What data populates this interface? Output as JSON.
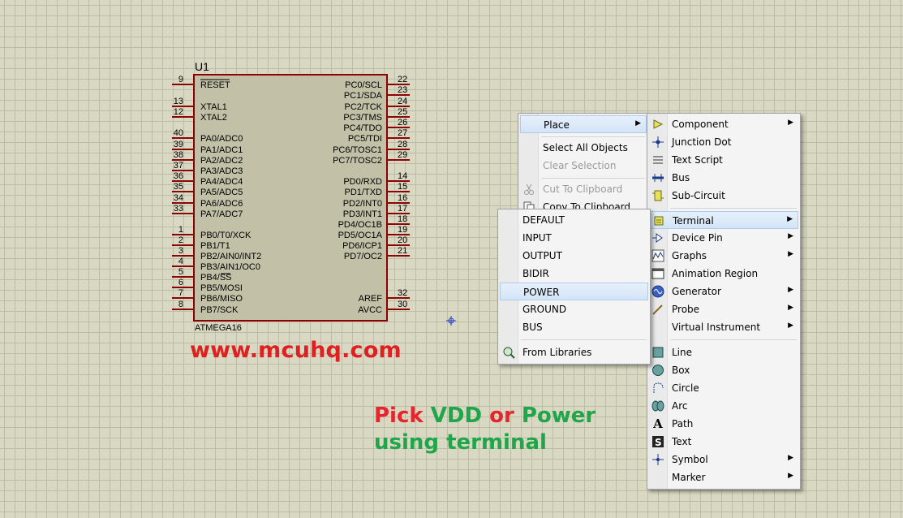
{
  "schematic": {
    "ref": "U1",
    "part": "ATMEGA16",
    "left_pins": [
      {
        "num": "9",
        "name": "RESET"
      },
      {
        "num": "13",
        "name": "XTAL1"
      },
      {
        "num": "12",
        "name": "XTAL2"
      },
      {
        "num": "40",
        "name": "PA0/ADC0"
      },
      {
        "num": "39",
        "name": "PA1/ADC1"
      },
      {
        "num": "38",
        "name": "PA2/ADC2"
      },
      {
        "num": "37",
        "name": "PA3/ADC3"
      },
      {
        "num": "36",
        "name": "PA4/ADC4"
      },
      {
        "num": "35",
        "name": "PA5/ADC5"
      },
      {
        "num": "34",
        "name": "PA6/ADC6"
      },
      {
        "num": "33",
        "name": "PA7/ADC7"
      },
      {
        "num": "1",
        "name": "PB0/T0/XCK"
      },
      {
        "num": "2",
        "name": "PB1/T1"
      },
      {
        "num": "3",
        "name": "PB2/AIN0/INT2"
      },
      {
        "num": "4",
        "name": "PB3/AIN1/OC0"
      },
      {
        "num": "5",
        "name": "PB4/SS"
      },
      {
        "num": "6",
        "name": "PB5/MOSI"
      },
      {
        "num": "7",
        "name": "PB6/MISO"
      },
      {
        "num": "8",
        "name": "PB7/SCK"
      }
    ],
    "right_pins": [
      {
        "num": "22",
        "name": "PC0/SCL"
      },
      {
        "num": "23",
        "name": "PC1/SDA"
      },
      {
        "num": "24",
        "name": "PC2/TCK"
      },
      {
        "num": "25",
        "name": "PC3/TMS"
      },
      {
        "num": "26",
        "name": "PC4/TDO"
      },
      {
        "num": "27",
        "name": "PC5/TDI"
      },
      {
        "num": "28",
        "name": "PC6/TOSC1"
      },
      {
        "num": "29",
        "name": "PC7/TOSC2"
      },
      {
        "num": "14",
        "name": "PD0/RXD"
      },
      {
        "num": "15",
        "name": "PD1/TXD"
      },
      {
        "num": "16",
        "name": "PD2/INT0"
      },
      {
        "num": "17",
        "name": "PD3/INT1"
      },
      {
        "num": "18",
        "name": "PD4/OC1B"
      },
      {
        "num": "19",
        "name": "PD5/OC1A"
      },
      {
        "num": "20",
        "name": "PD6/ICP1"
      },
      {
        "num": "21",
        "name": "PD7/OC2"
      },
      {
        "num": "32",
        "name": "AREF"
      },
      {
        "num": "30",
        "name": "AVCC"
      }
    ]
  },
  "watermark": "www.mcuhq.com",
  "annotation": {
    "pick": "Pick",
    "vdd": "VDD",
    "or": "or",
    "power": "Power",
    "line2": "using terminal"
  },
  "main_menu": {
    "place": "Place",
    "select_all": "Select All Objects",
    "clear_selection": "Clear Selection",
    "cut": "Cut To Clipboard",
    "copy": "Copy To Clipboard"
  },
  "object_menu": {
    "component": "Component",
    "junction_dot": "Junction Dot",
    "text_script": "Text Script",
    "bus": "Bus",
    "sub_circuit": "Sub-Circuit",
    "terminal": "Terminal",
    "device_pin": "Device Pin",
    "graphs": "Graphs",
    "animation_region": "Animation Region",
    "generator": "Generator",
    "probe": "Probe",
    "virtual_instrument": "Virtual Instrument",
    "line": "Line",
    "box": "Box",
    "circle": "Circle",
    "arc": "Arc",
    "path": "Path",
    "text": "Text",
    "symbol": "Symbol",
    "marker": "Marker"
  },
  "terminal_menu": {
    "default": "DEFAULT",
    "input": "INPUT",
    "output": "OUTPUT",
    "bidir": "BIDIR",
    "power": "POWER",
    "ground": "GROUND",
    "bus": "BUS",
    "from_libraries": "From Libraries"
  },
  "colors": {
    "canvas": "#d9d8c2",
    "grid": "#bdbca6",
    "pin": "#8b0000",
    "watermark": "#e02020",
    "annot_green": "#1fa64a",
    "menu_highlight": "#d3e4f7"
  },
  "icons": {
    "place": "none",
    "component": "component-arrow-icon",
    "junction_dot": "junction-dot-icon",
    "text_script": "text-script-icon",
    "bus": "bus-icon",
    "sub_circuit": "sub-circuit-icon",
    "terminal": "terminal-icon",
    "device_pin": "device-pin-icon",
    "graphs": "graph-icon",
    "animation_region": "animation-region-icon",
    "generator": "generator-icon",
    "probe": "probe-icon",
    "line": "line-square-icon",
    "box": "box-circle-icon",
    "circle": "circle-outline-icon",
    "arc": "arc-icon",
    "path": "path-A-icon",
    "text": "text-S-icon",
    "symbol": "symbol-icon",
    "from_libraries": "magnifier-library-icon"
  }
}
